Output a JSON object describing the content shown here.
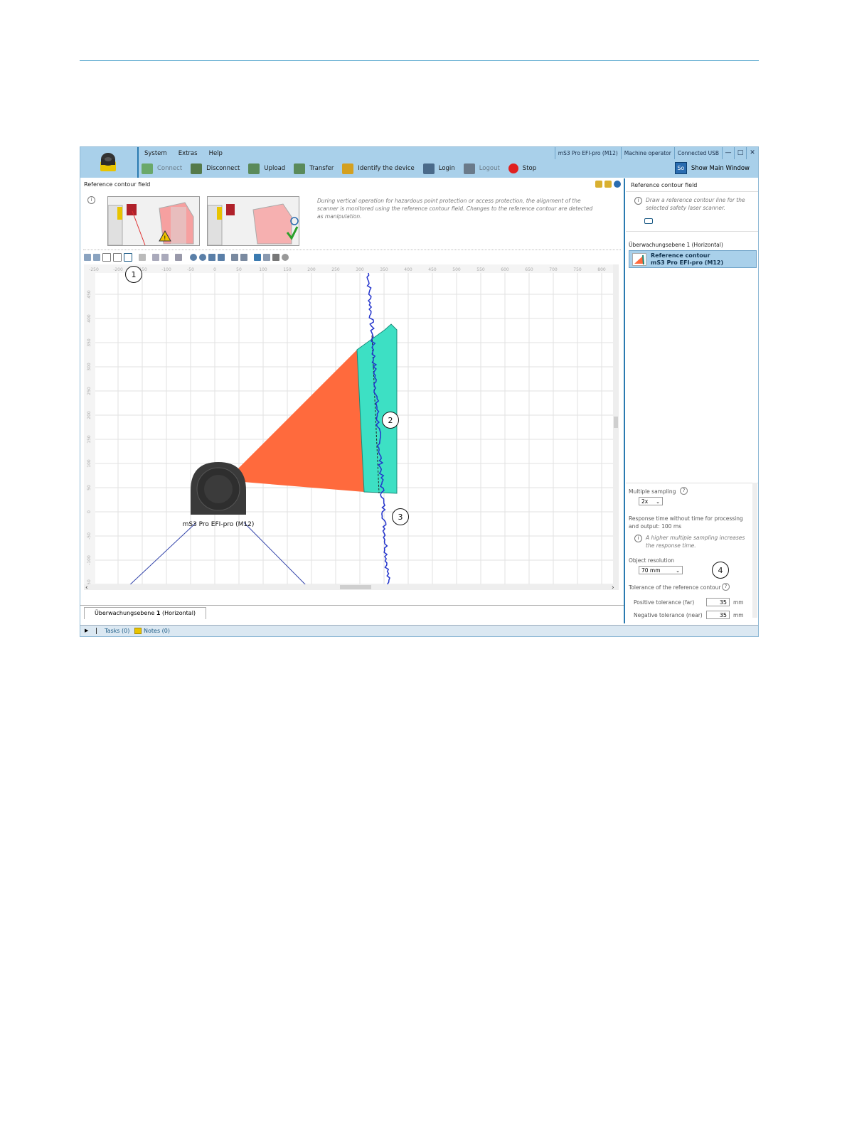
{
  "menu": [
    "System",
    "Extras",
    "Help"
  ],
  "status": {
    "device": "mS3 Pro EFI-pro (M12)",
    "user": "Machine operator",
    "connection": "Connected USB"
  },
  "window_buttons": [
    "minimize-icon",
    "maximize-icon",
    "close-icon"
  ],
  "toolbar": [
    {
      "label": "Connect",
      "enabled": false
    },
    {
      "label": "Disconnect",
      "enabled": true
    },
    {
      "label": "Upload",
      "enabled": true
    },
    {
      "label": "Transfer",
      "enabled": true
    },
    {
      "label": "Identify the device",
      "enabled": true
    },
    {
      "label": "Login",
      "enabled": true
    },
    {
      "label": "Logout",
      "enabled": false
    },
    {
      "label": "Stop",
      "enabled": true
    }
  ],
  "show_main_window": {
    "icon_text": "So",
    "label": "Show Main Window"
  },
  "left_panel": {
    "title": "Reference contour field",
    "description": "During vertical operation for hazardous point protection or access protection, the alignment of the scanner is monitored using the reference contour field. Changes to the reference contour are detected as manipulation.",
    "ruler_x": [
      "-250",
      "-200",
      "-150",
      "-100",
      "-50",
      "0",
      "50",
      "100",
      "150",
      "200",
      "250",
      "300",
      "350",
      "400",
      "450",
      "500",
      "550",
      "600",
      "650",
      "700",
      "750",
      "800"
    ],
    "ruler_y": [
      "450",
      "400",
      "350",
      "300",
      "250",
      "200",
      "150",
      "100",
      "50",
      "0",
      "-50",
      "-100",
      "-150",
      "-200"
    ],
    "device_label": "mS3 Pro EFI-pro (M12)",
    "tab": "Überwachungsebene 1 (Horizontal)",
    "tab_bold": "1"
  },
  "colors": {
    "accent": "#a9d0ea",
    "field_orange": "#ff6a3d",
    "field_teal": "#3de0c4",
    "contour_blue": "#2233cc"
  },
  "right_panel": {
    "title": "Reference contour field",
    "hint": "Draw a reference contour line for the selected safety laser scanner.",
    "level": "Überwachungsebene 1 (Horizontal)",
    "item_title": "Reference contour",
    "item_subtitle": "mS3 Pro EFI-pro (M12)",
    "multiple_sampling_label": "Multiple sampling",
    "multiple_sampling_value": "2x",
    "response_time": "Response time without time for processing and output: 100 ms",
    "sampling_hint": "A higher multiple sampling increases the response time.",
    "object_resolution_label": "Object resolution",
    "object_resolution_value": "70 mm",
    "tolerance_label": "Tolerance of the reference contour",
    "positive_label": "Positive tolerance (far)",
    "positive_value": "35",
    "negative_label": "Negative tolerance (near)",
    "negative_value": "35",
    "unit": "mm"
  },
  "bottom_bar": {
    "tasks": "Tasks (0)",
    "notes": "Notes (0)"
  },
  "callouts": [
    "1",
    "2",
    "3",
    "4"
  ]
}
